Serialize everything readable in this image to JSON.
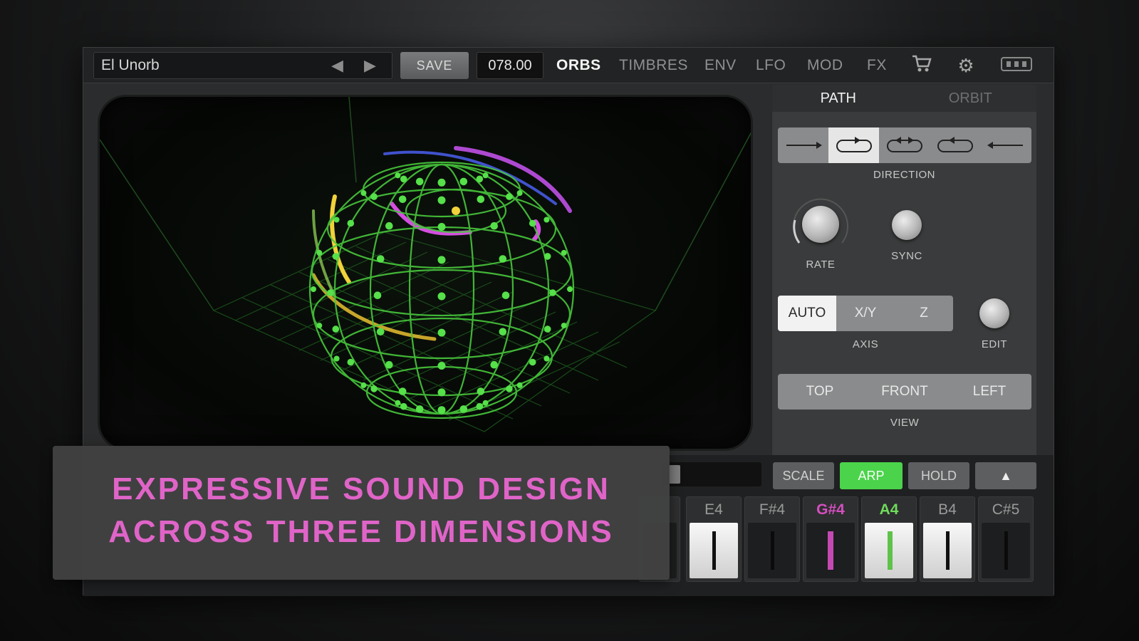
{
  "topbar": {
    "preset_name": "El Unorb",
    "prev_icon": "triangle-left-icon",
    "next_icon": "triangle-right-icon",
    "save_label": "SAVE",
    "tempo_value": "078.00",
    "tabs": [
      {
        "label": "ORBS",
        "active": true
      },
      {
        "label": "TIMBRES",
        "active": false
      },
      {
        "label": "ENV",
        "active": false
      },
      {
        "label": "LFO",
        "active": false
      },
      {
        "label": "MOD",
        "active": false
      },
      {
        "label": "FX",
        "active": false
      }
    ],
    "icons": [
      "cart-icon",
      "gear-icon",
      "midi-icon"
    ]
  },
  "panel": {
    "tabs": [
      {
        "label": "PATH",
        "active": true
      },
      {
        "label": "ORBIT",
        "active": false
      }
    ],
    "direction_label": "DIRECTION",
    "direction_selected": 1,
    "rate_label": "RATE",
    "sync_label": "SYNC",
    "axis": {
      "label": "AXIS",
      "options": [
        "AUTO",
        "X/Y",
        "Z"
      ],
      "selected": "AUTO"
    },
    "edit_label": "EDIT",
    "view": {
      "label": "VIEW",
      "options": [
        "TOP",
        "FRONT",
        "LEFT"
      ]
    }
  },
  "controls": {
    "scale_label": "SCALE",
    "arp_label": "ARP",
    "hold_label": "HOLD",
    "up_icon": "triangle-up-icon"
  },
  "keys": [
    {
      "note": "E4",
      "color": "#9a9a9a",
      "white": true,
      "line": "#111111"
    },
    {
      "note": "F#4",
      "color": "#9a9a9a",
      "white": false,
      "line": "#111111"
    },
    {
      "note": "G#4",
      "color": "#d44fc0",
      "white": false,
      "line": "#c449b4"
    },
    {
      "note": "A4",
      "color": "#6fdc5a",
      "white": true,
      "line": "#5fc24a"
    },
    {
      "note": "B4",
      "color": "#9a9a9a",
      "white": true,
      "line": "#111111"
    },
    {
      "note": "C#5",
      "color": "#9a9a9a",
      "white": false,
      "line": "#111111"
    }
  ],
  "overlay": {
    "line1": "EXPRESSIVE SOUND DESIGN",
    "line2": "ACROSS THREE DIMENSIONS",
    "color": "#e064c8"
  },
  "colors": {
    "orb_green": "#56e04a",
    "trail_yellow": "#f0d23a",
    "trail_magenta": "#d44fe0",
    "trail_blue": "#4a5ff0",
    "arp_active": "#4bd34b"
  }
}
